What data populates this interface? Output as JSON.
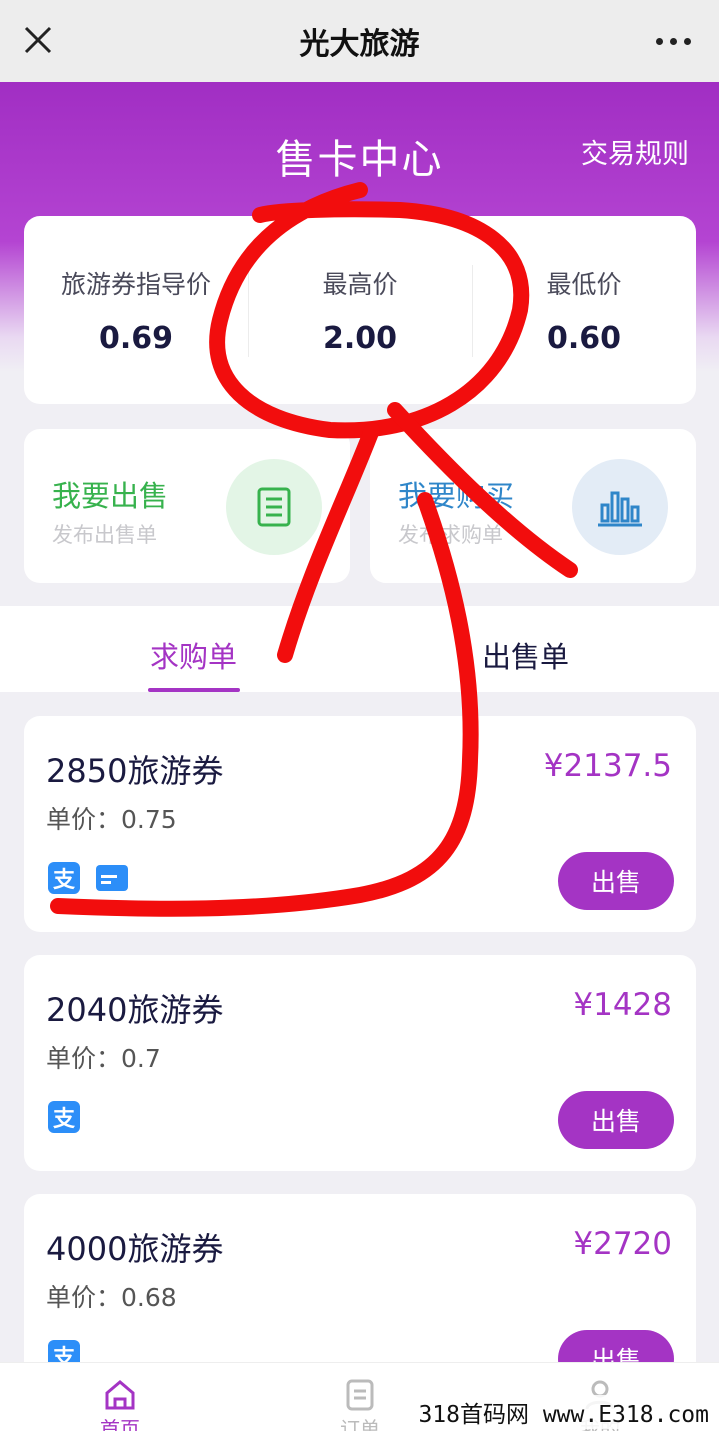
{
  "topbar": {
    "title": "光大旅游"
  },
  "hero": {
    "title": "售卡中心",
    "rules_label": "交易规则"
  },
  "prices": [
    {
      "label": "旅游券指导价",
      "value": "0.69"
    },
    {
      "label": "最高价",
      "value": "2.00"
    },
    {
      "label": "最低价",
      "value": "0.60"
    }
  ],
  "actions": {
    "sell": {
      "title": "我要出售",
      "subtitle": "发布出售单"
    },
    "buy": {
      "title": "我要购买",
      "subtitle": "发布求购单"
    }
  },
  "tabs": [
    {
      "label": "求购单"
    },
    {
      "label": "出售单"
    }
  ],
  "orders": [
    {
      "name": "2850旅游券",
      "unit_price": "单价：0.75",
      "amount": "¥2137.5",
      "button": "出售",
      "payment": [
        "alipay-icon",
        "bank-card-icon"
      ]
    },
    {
      "name": "2040旅游券",
      "unit_price": "单价：0.7",
      "amount": "¥1428",
      "button": "出售",
      "payment": [
        "alipay-icon"
      ]
    },
    {
      "name": "4000旅游券",
      "unit_price": "单价：0.68",
      "amount": "¥2720",
      "button": "出售",
      "payment": [
        "alipay-icon"
      ]
    }
  ],
  "payment_glyph": "支",
  "bottom_nav": [
    {
      "label": "首页"
    },
    {
      "label": "订单"
    },
    {
      "label": "我的"
    }
  ],
  "watermark": "318首码网 www.E318.com",
  "colors": {
    "accent": "#a434c4",
    "sell_green": "#37b24d",
    "buy_blue": "#2f86c9",
    "alipay_blue": "#2c8ef8",
    "scribble_red": "#f20d0d"
  }
}
